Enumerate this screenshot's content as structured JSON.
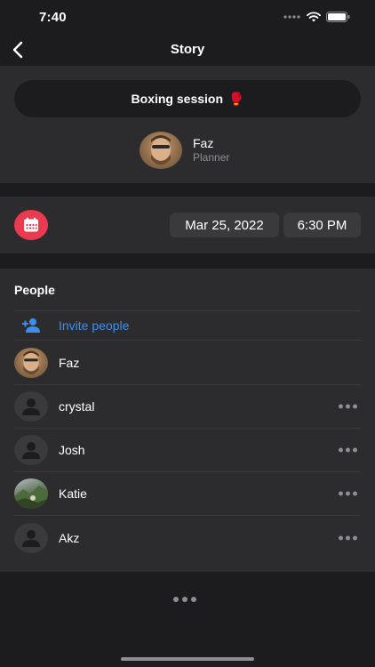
{
  "status_bar": {
    "time": "7:40"
  },
  "nav": {
    "title": "Story"
  },
  "event": {
    "name": "Boxing session",
    "emoji": "🥊",
    "planner": {
      "name": "Faz",
      "role": "Planner"
    }
  },
  "schedule": {
    "date": "Mar 25, 2022",
    "time": "6:30 PM"
  },
  "people": {
    "title": "People",
    "invite_label": "Invite people",
    "members": [
      {
        "name": "Faz",
        "avatar": "photo-faz"
      },
      {
        "name": "crystal",
        "avatar": "default"
      },
      {
        "name": "Josh",
        "avatar": "default"
      },
      {
        "name": "Katie",
        "avatar": "photo-katie"
      },
      {
        "name": "Akz",
        "avatar": "default"
      }
    ]
  },
  "colors": {
    "accent_blue": "#3d8ef0",
    "calendar_red": "#ea3a4f",
    "background": "#1c1c1e",
    "card": "#2c2c2e"
  },
  "icons": [
    "chevron-left-icon",
    "calendar-icon",
    "add-person-icon",
    "person-silhouette-icon",
    "more-horizontal-icon"
  ]
}
